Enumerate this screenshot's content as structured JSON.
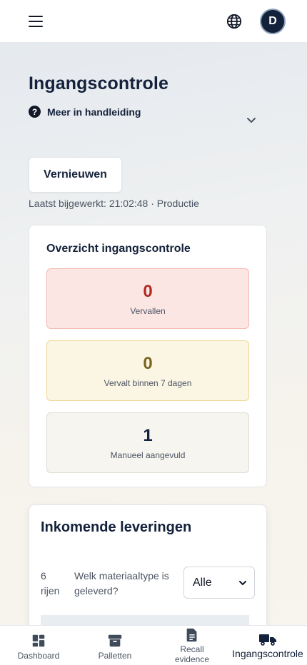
{
  "header": {
    "menu_icon": "hamburger-menu-icon",
    "language_icon": "globe-icon",
    "avatar_initial": "D"
  },
  "page": {
    "title": "Ingangscontrole",
    "help_icon": "question-circle-icon",
    "help_label": "Meer in handleiding",
    "expand_icon": "chevron-down-icon",
    "refresh_label": "Vernieuwen",
    "last_updated": "Laatst bijgewerkt: 21:02:48 · Productie"
  },
  "overview": {
    "title": "Overzicht ingangscontrole",
    "stats": [
      {
        "value": "0",
        "label": "Vervallen",
        "color": "#b02a20"
      },
      {
        "value": "0",
        "label": "Vervalt binnen 7 dagen",
        "color": "#7a6420"
      },
      {
        "value": "1",
        "label": "Manueel aangevuld",
        "color": "#14213a"
      }
    ]
  },
  "deliveries": {
    "title": "Inkomende leveringen",
    "row_count": "6 rijen",
    "filter_label": "Welk materiaaltype is geleverd?",
    "filter_value": "Alle"
  },
  "bottom_nav": {
    "items": [
      {
        "label": "Dashboard",
        "icon": "dashboard-grid-icon"
      },
      {
        "label": "Palletten",
        "icon": "archive-box-icon"
      },
      {
        "label": "Recall evidence",
        "icon": "document-icon"
      },
      {
        "label": "Ingangscontrole",
        "icon": "truck-icon",
        "active": true
      }
    ]
  },
  "colors": {
    "primary": "#14213a",
    "danger_bg": "#fbe6e4",
    "warning_bg": "#fbf5e4",
    "neutral_bg": "#f7f5ef"
  }
}
